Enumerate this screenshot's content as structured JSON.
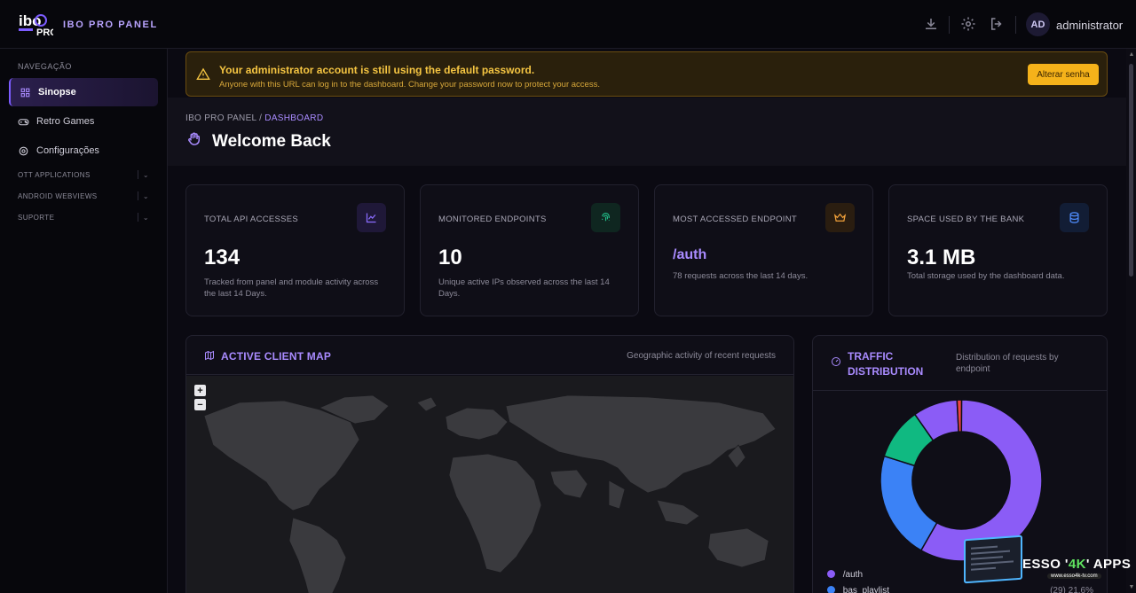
{
  "header": {
    "brand": "IBO PRO PANEL",
    "user_initials": "AD",
    "username": "administrator"
  },
  "sidebar": {
    "heading": "NAVEGAÇÃO",
    "items": [
      {
        "label": "Sinopse",
        "icon": "grid-icon",
        "active": true
      },
      {
        "label": "Retro Games",
        "icon": "gamepad-icon",
        "active": false
      },
      {
        "label": "Configurações",
        "icon": "gear-icon",
        "active": false
      }
    ],
    "sections": [
      {
        "label": "OTT APPLICATIONS"
      },
      {
        "label": "ANDROID WEBVIEWS"
      },
      {
        "label": "SUPORTE"
      }
    ]
  },
  "alert": {
    "title": "Your administrator account is still using the default password.",
    "text": "Anyone with this URL can log in to the dashboard. Change your password now to protect your access.",
    "button": "Alterar senha"
  },
  "page": {
    "breadcrumb_root": "IBO PRO PANEL /",
    "breadcrumb_current": "DASHBOARD",
    "title": "Welcome Back"
  },
  "stats": [
    {
      "label": "TOTAL API ACCESSES",
      "value": "134",
      "desc": "Tracked from panel and module activity across the last 14 Days.",
      "icon": "trend-chart-icon",
      "color": "#8b6cff"
    },
    {
      "label": "MONITORED ENDPOINTS",
      "value": "10",
      "desc": "Unique active IPs observed across the last 14 Days.",
      "icon": "fingerprint-icon",
      "color": "#22c08a"
    },
    {
      "label": "MOST ACCESSED ENDPOINT",
      "value": "/auth",
      "desc": "78 requests across the last 14 days.",
      "icon": "crown-icon",
      "color": "#f0a03a"
    },
    {
      "label": "SPACE USED BY THE BANK",
      "value": "3.1 MB",
      "desc": "Total storage used by the dashboard data.",
      "icon": "database-icon",
      "color": "#4f8dff"
    }
  ],
  "map": {
    "title": "ACTIVE CLIENT MAP",
    "subtitle": "Geographic activity of recent requests",
    "zoom_in": "+",
    "zoom_out": "−"
  },
  "traffic": {
    "title": "TRAFFIC DISTRIBUTION",
    "subtitle": "Distribution of requests by endpoint",
    "legend": [
      {
        "label": "/auth",
        "value": "",
        "color": "#8b5cf6"
      },
      {
        "label": "bas_playlist",
        "value": "(29)   21.6%",
        "color": "#3b82f6"
      }
    ]
  },
  "chart_data": {
    "type": "pie",
    "title": "",
    "categories": [
      "/auth",
      "bas_playlist",
      "",
      "",
      ""
    ],
    "values": [
      58.2,
      21.6,
      10.4,
      8.9,
      0.9
    ],
    "colors": [
      "#8b5cf6",
      "#3b82f6",
      "#10b981",
      "#8b5cf6",
      "#ef4444"
    ]
  },
  "watermark": {
    "text_left": "ESSO '",
    "text_green": "4K",
    "text_right": "' APPS",
    "url": "www.esso4k-tv.com"
  }
}
